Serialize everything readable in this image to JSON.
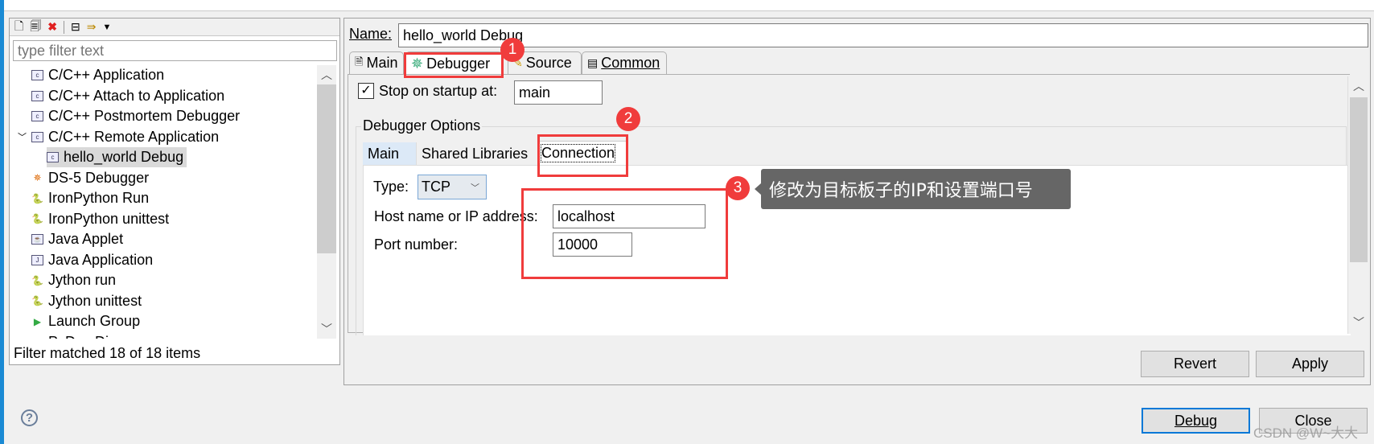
{
  "sidebar": {
    "filter_placeholder": "type filter text",
    "items": [
      {
        "label": "C/C++ Application",
        "icon": "c-app-icon"
      },
      {
        "label": "C/C++ Attach to Application",
        "icon": "c-app-icon"
      },
      {
        "label": "C/C++ Postmortem Debugger",
        "icon": "c-app-icon"
      },
      {
        "label": "C/C++ Remote Application",
        "icon": "c-app-icon"
      },
      {
        "label": "hello_world Debug",
        "icon": "c-app-icon"
      },
      {
        "label": "DS-5 Debugger",
        "icon": "bug-icon"
      },
      {
        "label": "IronPython Run",
        "icon": "python-icon"
      },
      {
        "label": "IronPython unittest",
        "icon": "python-unittest-icon"
      },
      {
        "label": "Java Applet",
        "icon": "java-applet-icon"
      },
      {
        "label": "Java Application",
        "icon": "java-app-icon"
      },
      {
        "label": "Jython run",
        "icon": "jython-icon"
      },
      {
        "label": "Jython unittest",
        "icon": "jython-unittest-icon"
      },
      {
        "label": "Launch Group",
        "icon": "launch-group-icon"
      },
      {
        "label": "PyDev Django",
        "icon": "pydev-icon"
      }
    ],
    "status": "Filter matched 18 of 18 items"
  },
  "main": {
    "name_label": "Name:",
    "name_value": "hello_world Debug",
    "tabs": [
      "Main",
      "Debugger",
      "Source",
      "Common"
    ],
    "stop_label": "Stop on startup at:",
    "stop_checked": true,
    "stop_value": "main",
    "group_label": "Debugger Options",
    "inner_tabs": [
      "Main",
      "Shared Libraries",
      "Connection"
    ],
    "type_label": "Type:",
    "type_value": "TCP",
    "host_label": "Host name or IP address:",
    "host_value": "localhost",
    "port_label": "Port number:",
    "port_value": "10000",
    "revert": "Revert",
    "apply": "Apply"
  },
  "footer": {
    "debug": "Debug",
    "close": "Close"
  },
  "annotations": {
    "b1": "1",
    "b2": "2",
    "b3": "3",
    "tooltip": "修改为目标板子的IP和设置端口号",
    "color": "#f03c3c"
  },
  "watermark": "CSDN @W~大大"
}
